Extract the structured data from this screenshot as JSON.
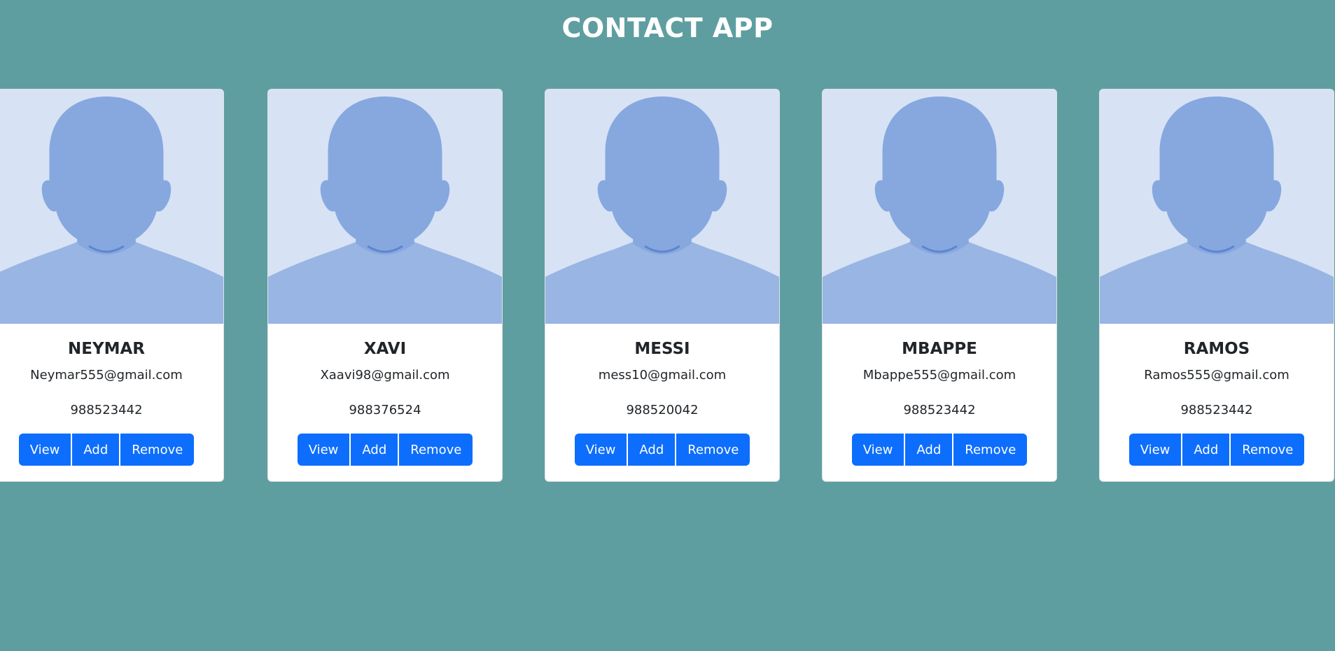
{
  "app": {
    "title": "CONTACT APP"
  },
  "colors": {
    "background": "#5f9ea0",
    "card": "#ffffff",
    "button": "#0d6efd",
    "avatar_bg": "#d7e2f4",
    "avatar_fg": "#86a8df"
  },
  "contacts": [
    {
      "name": "NEYMAR",
      "email": "Neymar555@gmail.com",
      "phone": "988523442",
      "avatar_icon": "person-silhouette-icon",
      "buttons": {
        "view": "View",
        "add": "Add",
        "remove": "Remove"
      }
    },
    {
      "name": "XAVI",
      "email": "Xaavi98@gmail.com",
      "phone": "988376524",
      "avatar_icon": "person-silhouette-icon",
      "buttons": {
        "view": "View",
        "add": "Add",
        "remove": "Remove"
      }
    },
    {
      "name": "MESSI",
      "email": "mess10@gmail.com",
      "phone": "988520042",
      "avatar_icon": "person-silhouette-icon",
      "buttons": {
        "view": "View",
        "add": "Add",
        "remove": "Remove"
      }
    },
    {
      "name": "MBAPPE",
      "email": "Mbappe555@gmail.com",
      "phone": "988523442",
      "avatar_icon": "person-silhouette-icon",
      "buttons": {
        "view": "View",
        "add": "Add",
        "remove": "Remove"
      }
    },
    {
      "name": "RAMOS",
      "email": "Ramos555@gmail.com",
      "phone": "988523442",
      "avatar_icon": "person-silhouette-icon",
      "buttons": {
        "view": "View",
        "add": "Add",
        "remove": "Remove"
      }
    }
  ]
}
